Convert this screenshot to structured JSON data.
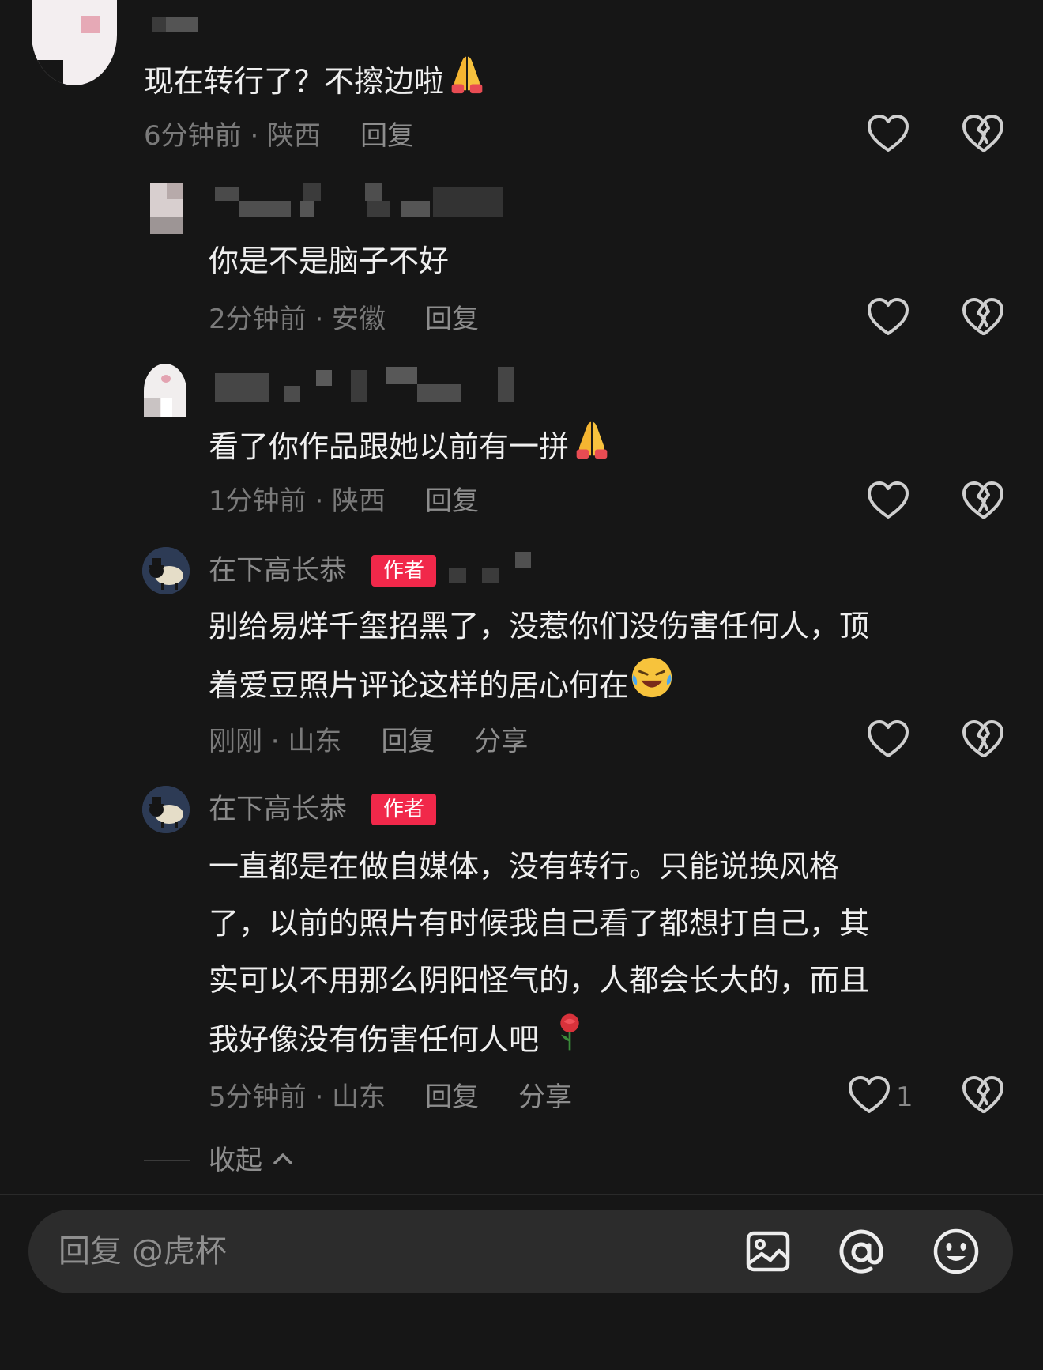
{
  "comments": [
    {
      "text": "现在转行了？不擦边啦",
      "emoji": "pray-emoji",
      "time_location": "6分钟前 · 陕西",
      "reply_label": "回复"
    },
    {
      "text": "你是不是脑子不好",
      "time_location": "2分钟前 · 安徽",
      "reply_label": "回复"
    },
    {
      "text": "看了你作品跟她以前有一拼",
      "emoji": "pray-emoji",
      "time_location": "1分钟前 · 陕西",
      "reply_label": "回复"
    },
    {
      "username": "在下高长恭",
      "badge": "作者",
      "text_lines": [
        "别给易烊千玺招黑了，没惹你们没伤害任何人，顶",
        "着爱豆照片评论这样的居心何在"
      ],
      "emoji": "crying-laughing-emoji",
      "time_location": "刚刚 · 山东",
      "reply_label": "回复",
      "share_label": "分享"
    },
    {
      "username": "在下高长恭",
      "badge": "作者",
      "text_lines": [
        "一直都是在做自媒体，没有转行。只能说换风格",
        "了，以前的照片有时候我自己看了都想打自己，其",
        "实可以不用那么阴阳怪气的，人都会长大的，而且",
        "我好像没有伤害任何人吧"
      ],
      "emoji": "rose-emoji",
      "time_location": "5分钟前 · 山东",
      "reply_label": "回复",
      "share_label": "分享",
      "like_count": "1"
    }
  ],
  "collapse_label": "收起",
  "reply_bar": {
    "placeholder": "回复 @虎杯"
  },
  "icons": {
    "like": "heart-icon",
    "dislike": "broken-heart-icon",
    "image": "image-icon",
    "mention": "at-icon",
    "emoji": "smiley-icon",
    "collapse": "chevron-up-icon"
  },
  "colors": {
    "background": "#161616",
    "author_badge": "#f1284a",
    "meta_text": "#7a7a7a",
    "reply_bar": "#2c2c2c"
  }
}
